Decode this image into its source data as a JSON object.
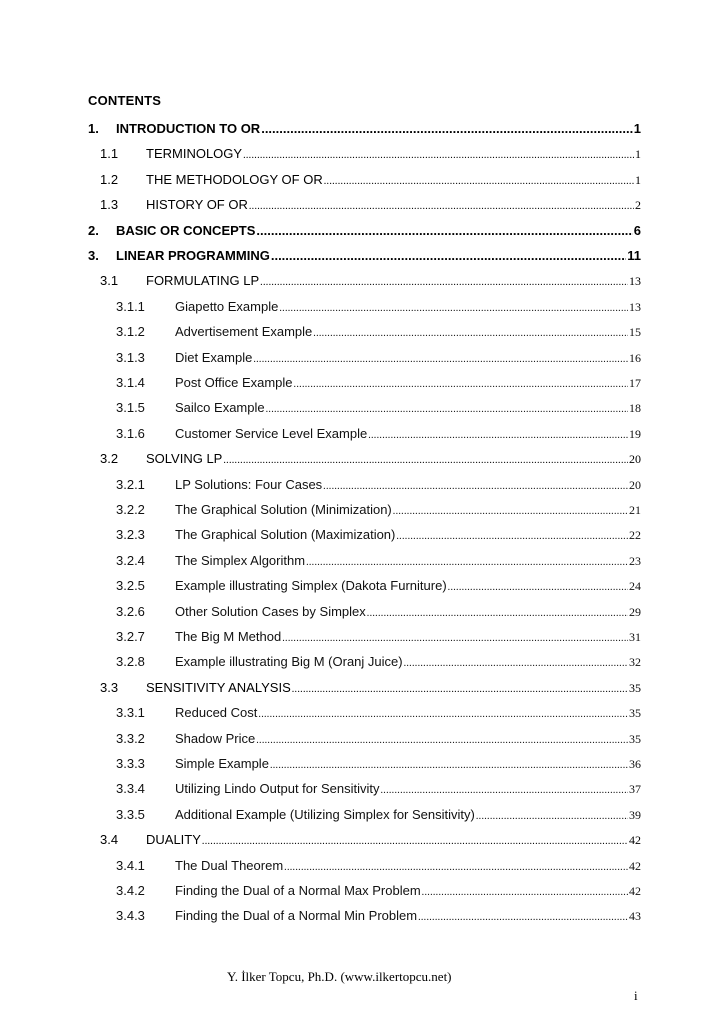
{
  "heading": "CONTENTS",
  "toc": [
    {
      "level": 1,
      "num": "1.",
      "title": "INTRODUCTION TO OR",
      "page": "1"
    },
    {
      "level": 2,
      "num": "1.1",
      "title": "TERMINOLOGY",
      "page": "1"
    },
    {
      "level": 2,
      "num": "1.2",
      "title": "THE METHODOLOGY OF OR",
      "page": "1"
    },
    {
      "level": 2,
      "num": "1.3",
      "title": "HISTORY OF OR",
      "page": "2"
    },
    {
      "level": 1,
      "num": "2.",
      "title": "BASIC OR CONCEPTS",
      "page": "6"
    },
    {
      "level": 1,
      "num": "3.",
      "title": "LINEAR PROGRAMMING",
      "page": "11"
    },
    {
      "level": 2,
      "num": "3.1",
      "title": "FORMULATING LP",
      "page": "13"
    },
    {
      "level": 3,
      "num": "3.1.1",
      "title": "Giapetto Example",
      "page": "13"
    },
    {
      "level": 3,
      "num": "3.1.2",
      "title": "Advertisement Example",
      "page": "15"
    },
    {
      "level": 3,
      "num": "3.1.3",
      "title": "Diet Example",
      "page": "16"
    },
    {
      "level": 3,
      "num": "3.1.4",
      "title": "Post Office Example",
      "page": "17"
    },
    {
      "level": 3,
      "num": "3.1.5",
      "title": "Sailco Example",
      "page": "18"
    },
    {
      "level": 3,
      "num": "3.1.6",
      "title": "Customer Service Level Example",
      "page": "19"
    },
    {
      "level": 2,
      "num": "3.2",
      "title": "SOLVING LP",
      "page": "20"
    },
    {
      "level": 3,
      "num": "3.2.1",
      "title": "LP Solutions: Four Cases",
      "page": "20"
    },
    {
      "level": 3,
      "num": "3.2.2",
      "title": "The Graphical Solution (Minimization)",
      "page": "21"
    },
    {
      "level": 3,
      "num": "3.2.3",
      "title": "The Graphical Solution (Maximization)",
      "page": "22"
    },
    {
      "level": 3,
      "num": "3.2.4",
      "title": "The Simplex Algorithm",
      "page": "23"
    },
    {
      "level": 3,
      "num": "3.2.5",
      "title": "Example illustrating Simplex (Dakota Furniture)",
      "page": "24"
    },
    {
      "level": 3,
      "num": "3.2.6",
      "title": "Other Solution Cases by Simplex",
      "page": "29"
    },
    {
      "level": 3,
      "num": "3.2.7",
      "title": "The Big M Method",
      "page": "31"
    },
    {
      "level": 3,
      "num": "3.2.8",
      "title": "Example illustrating Big M (Oranj Juice)",
      "page": "32"
    },
    {
      "level": 2,
      "num": "3.3",
      "title": "SENSITIVITY ANALYSIS",
      "page": "35"
    },
    {
      "level": 3,
      "num": "3.3.1",
      "title": "Reduced Cost",
      "page": "35"
    },
    {
      "level": 3,
      "num": "3.3.2",
      "title": "Shadow Price",
      "page": "35"
    },
    {
      "level": 3,
      "num": "3.3.3",
      "title": "Simple Example",
      "page": "36"
    },
    {
      "level": 3,
      "num": "3.3.4",
      "title": "Utilizing Lindo Output for Sensitivity",
      "page": "37"
    },
    {
      "level": 3,
      "num": "3.3.5",
      "title": "Additional Example (Utilizing Simplex for Sensitivity)",
      "page": "39"
    },
    {
      "level": 2,
      "num": "3.4",
      "title": "DUALITY",
      "page": "42"
    },
    {
      "level": 3,
      "num": "3.4.1",
      "title": "The Dual Theorem",
      "page": "42"
    },
    {
      "level": 3,
      "num": "3.4.2",
      "title": "Finding the Dual of a Normal Max Problem",
      "page": "42"
    },
    {
      "level": 3,
      "num": "3.4.3",
      "title": "Finding the Dual of a Normal Min Problem",
      "page": "43"
    }
  ],
  "footer": {
    "author": "Y. İlker Topcu, Ph.D. (www.ilkertopcu.net)",
    "page_number": "i"
  }
}
